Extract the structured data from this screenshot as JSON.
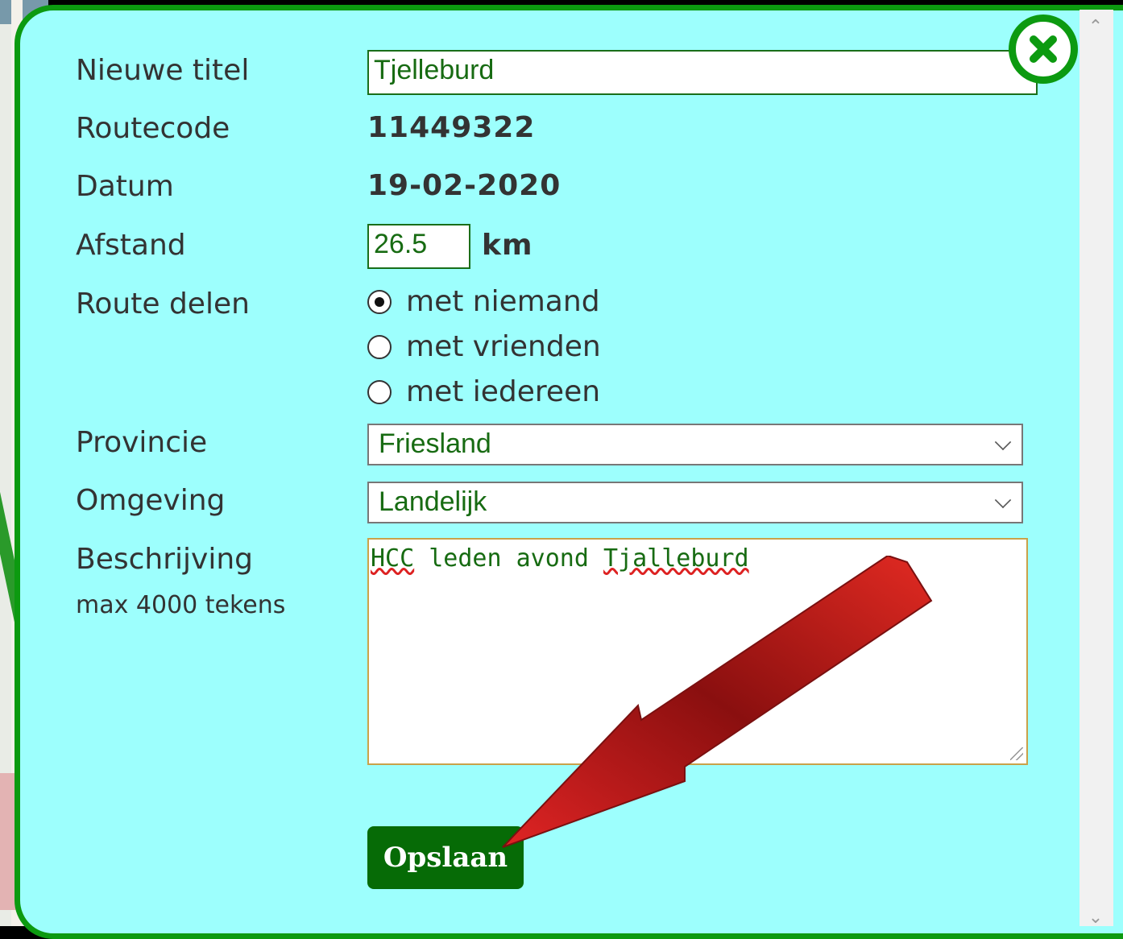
{
  "form": {
    "title_label": "Nieuwe titel",
    "title_value": "Tjelleburd",
    "routecode_label": "Routecode",
    "routecode_value": "11449322",
    "datum_label": "Datum",
    "datum_value": "19-02-2020",
    "afstand_label": "Afstand",
    "afstand_value": "26.5",
    "afstand_unit": "km",
    "delen_label": "Route delen",
    "delen_options": [
      {
        "label": "met niemand",
        "selected": true
      },
      {
        "label": "met vrienden",
        "selected": false
      },
      {
        "label": "met iedereen",
        "selected": false
      }
    ],
    "provincie_label": "Provincie",
    "provincie_value": "Friesland",
    "omgeving_label": "Omgeving",
    "omgeving_value": "Landelijk",
    "beschrijving_label": "Beschrijving",
    "beschrijving_hint": "max 4000 tekens",
    "beschrijving_value_parts": [
      "HCC",
      " leden avond ",
      "Tjalleburd"
    ],
    "save_label": "Opslaan"
  },
  "colors": {
    "dialog_bg": "#9dfffd",
    "dialog_border": "#0c9a10",
    "button_bg": "#066b06",
    "input_text": "#176b12",
    "arrow": "#d42020"
  },
  "icons": {
    "close": "close-x-icon",
    "dropdown": "chevron-down-icon",
    "annotation": "red-arrow"
  }
}
